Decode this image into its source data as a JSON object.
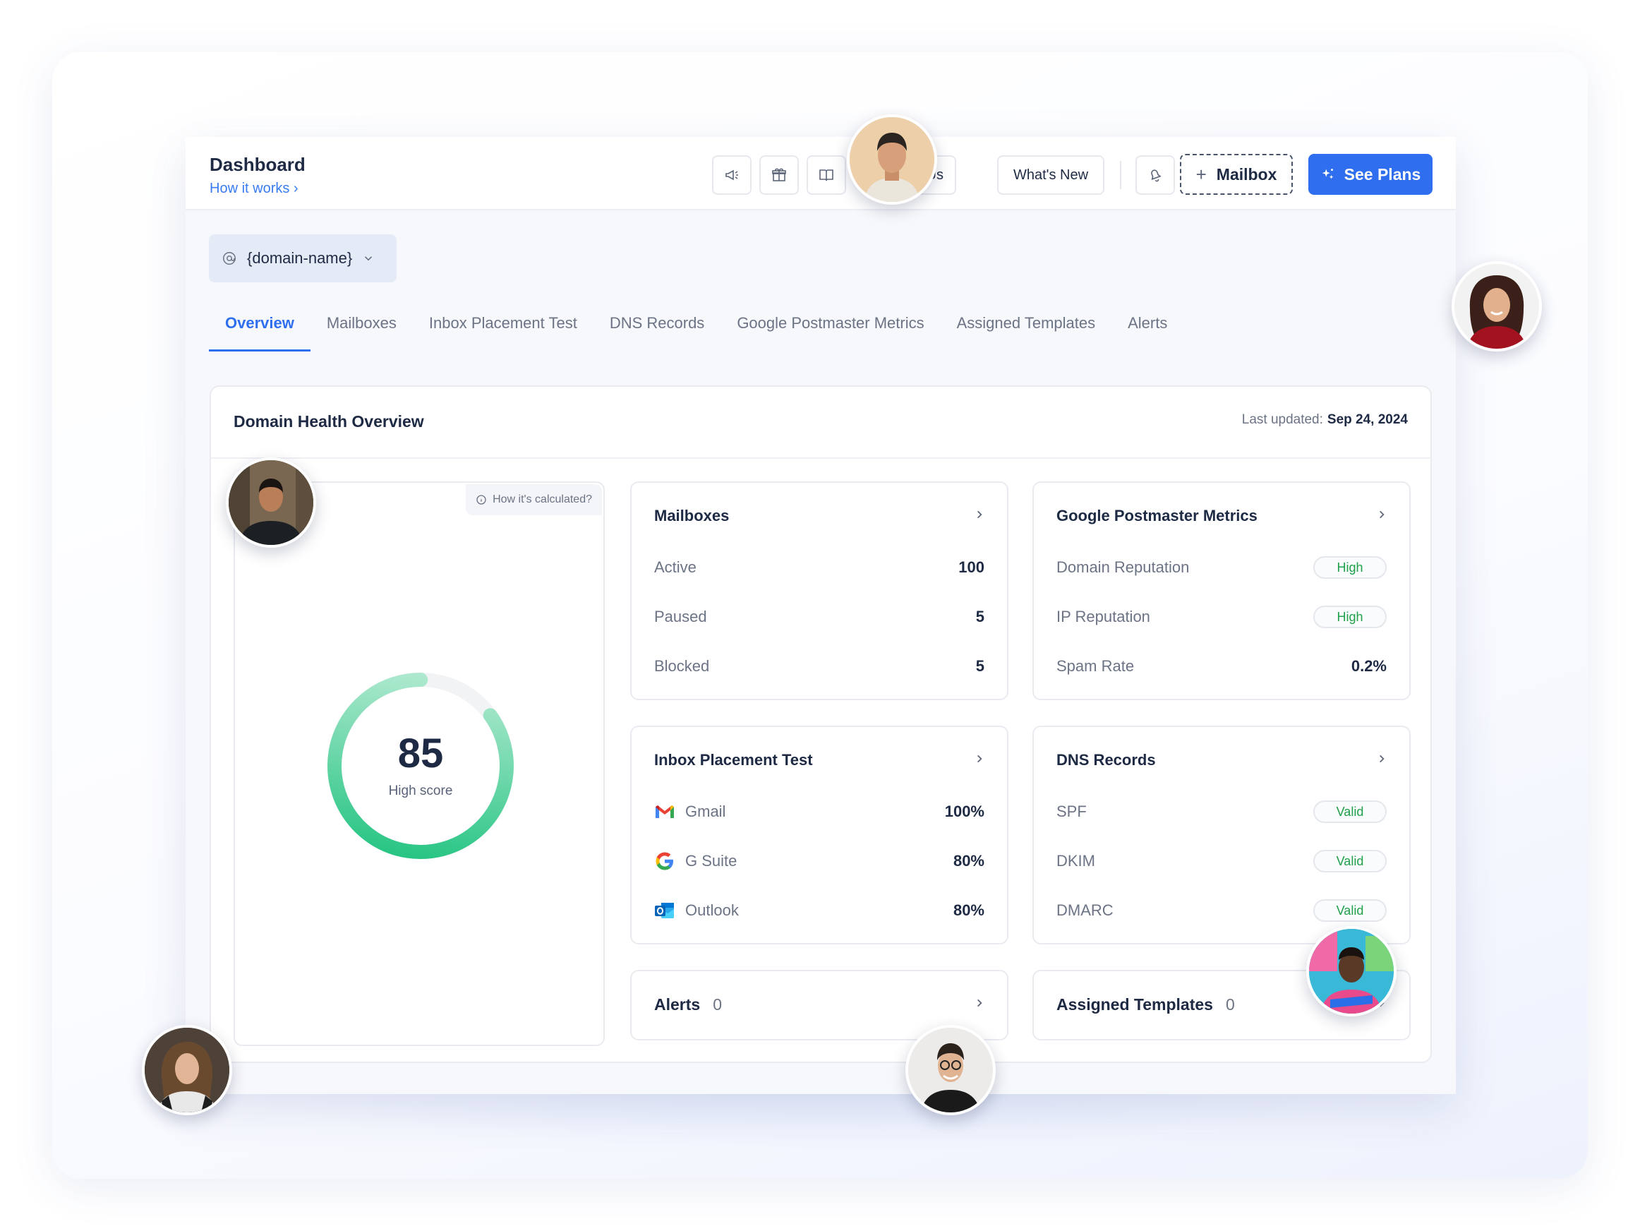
{
  "header": {
    "title": "Dashboard",
    "how_it_works": "How it works ›",
    "contact_label": "ct Us",
    "whats_new_label": "What's New",
    "mailbox_label": "Mailbox",
    "see_plans_label": "See Plans"
  },
  "domain_selector": {
    "value": "{domain-name}"
  },
  "tabs": [
    {
      "label": "Overview",
      "active": true
    },
    {
      "label": "Mailboxes"
    },
    {
      "label": "Inbox Placement Test"
    },
    {
      "label": "DNS Records"
    },
    {
      "label": "Google Postmaster Metrics"
    },
    {
      "label": "Assigned Templates"
    },
    {
      "label": "Alerts"
    }
  ],
  "overview": {
    "title": "Domain Health Overview",
    "last_updated_label": "Last updated:",
    "last_updated_value": "Sep 24, 2024",
    "how_calculated": "How it's calculated?",
    "score": {
      "value": "85",
      "label": "High score",
      "fraction": 0.85
    }
  },
  "mailboxes": {
    "title": "Mailboxes",
    "rows": [
      {
        "label": "Active",
        "value": "100"
      },
      {
        "label": "Paused",
        "value": "5"
      },
      {
        "label": "Blocked",
        "value": "5"
      }
    ]
  },
  "postmaster": {
    "title": "Google Postmaster Metrics",
    "rows": [
      {
        "label": "Domain Reputation",
        "value": "High"
      },
      {
        "label": "IP Reputation",
        "value": "High"
      },
      {
        "label": "Spam Rate",
        "value": "0.2%"
      }
    ]
  },
  "inbox_placement": {
    "title": "Inbox Placement Test",
    "rows": [
      {
        "label": "Gmail",
        "value": "100%",
        "icon": "gmail-icon"
      },
      {
        "label": "G Suite",
        "value": "80%",
        "icon": "google-icon"
      },
      {
        "label": "Outlook",
        "value": "80%",
        "icon": "outlook-icon"
      }
    ]
  },
  "dns": {
    "title": "DNS Records",
    "rows": [
      {
        "label": "SPF",
        "value": "Valid"
      },
      {
        "label": "DKIM",
        "value": "Valid"
      },
      {
        "label": "DMARC",
        "value": "Valid"
      }
    ]
  },
  "alerts": {
    "title": "Alerts",
    "count": "0"
  },
  "assigned_templates": {
    "title": "Assigned Templates",
    "count": "0"
  },
  "colors": {
    "accent": "#2f6fef",
    "valid_green": "#1fa04b",
    "gauge_green": "#16c17e"
  }
}
